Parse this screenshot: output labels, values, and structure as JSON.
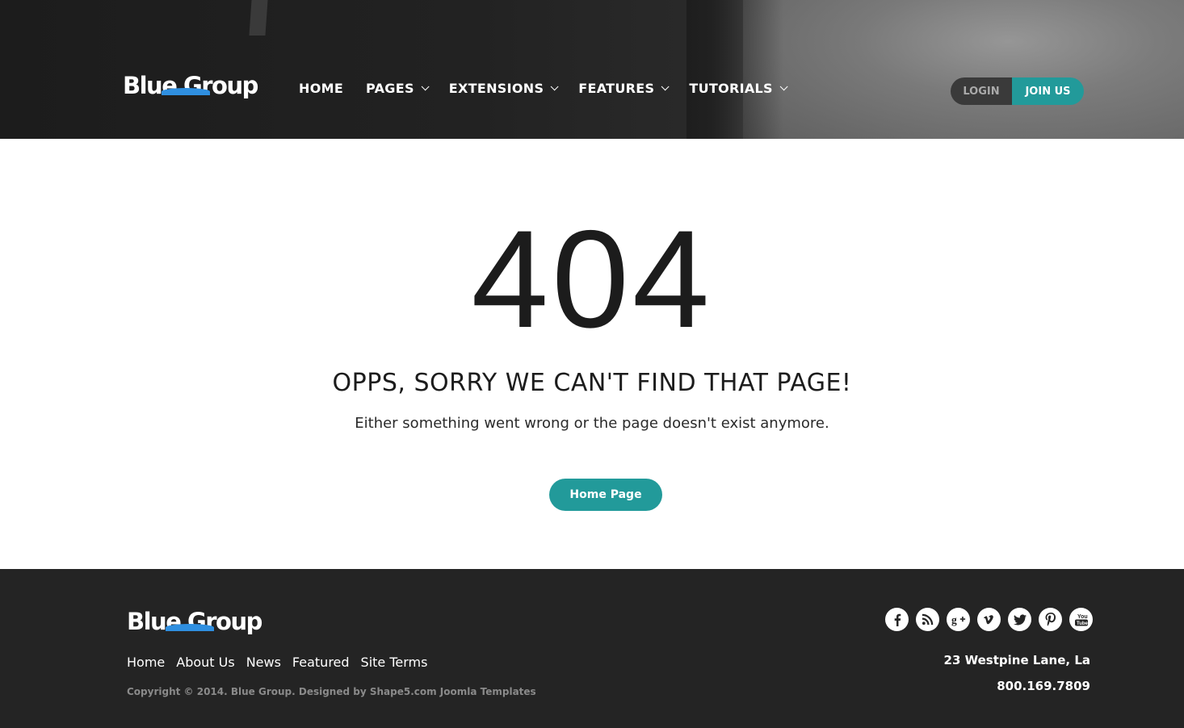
{
  "header": {
    "logo_text": "Blue Group",
    "nav": [
      {
        "label": "HOME",
        "has_dropdown": false
      },
      {
        "label": "PAGES",
        "has_dropdown": true
      },
      {
        "label": "EXTENSIONS",
        "has_dropdown": true
      },
      {
        "label": "FEATURES",
        "has_dropdown": true
      },
      {
        "label": "TUTORIALS",
        "has_dropdown": true
      }
    ],
    "login_label": "LOGIN",
    "join_label": "JOIN US"
  },
  "main": {
    "code": "404",
    "headline": "OPPS, SORRY WE CAN'T FIND THAT PAGE!",
    "subtext": "Either something went wrong or the page doesn't exist anymore.",
    "home_button": "Home Page"
  },
  "footer": {
    "logo_text": "Blue Group",
    "links": [
      "Home",
      "About Us",
      "News",
      "Featured",
      "Site Terms"
    ],
    "copyright": "Copyright © 2014. Blue Group. Designed by Shape5.com Joomla Templates",
    "social": [
      "facebook-icon",
      "rss-icon",
      "google-plus-icon",
      "vimeo-icon",
      "twitter-icon",
      "pinterest-icon",
      "youtube-icon"
    ],
    "address": "23 Westpine Lane, La",
    "phone": "800.169.7809"
  },
  "colors": {
    "accent": "#229a9a",
    "logo_arc": "#2f8fe0",
    "footer_bg": "#242424"
  }
}
